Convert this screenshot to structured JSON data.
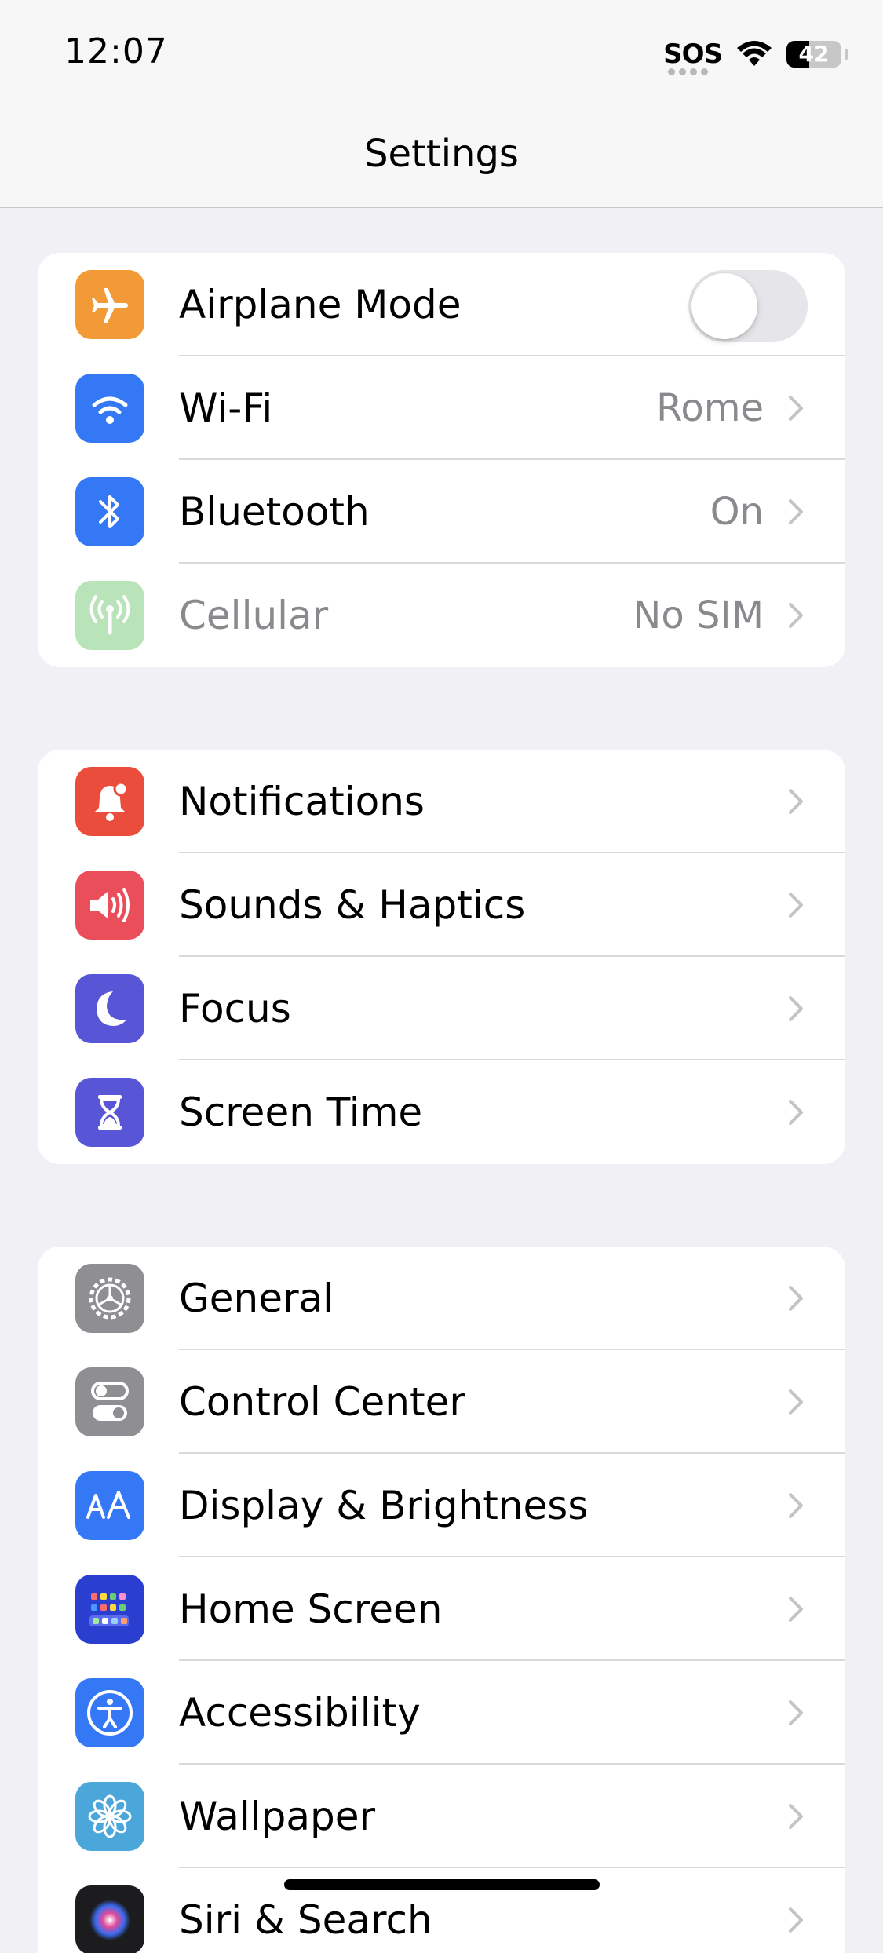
{
  "status_bar": {
    "time": "12:07",
    "carrier": "SOS",
    "battery": "42",
    "battery_level": 0.42
  },
  "nav": {
    "title": "Settings"
  },
  "groups": [
    {
      "rows": [
        {
          "label": "Airplane Mode",
          "icon": "airplane-icon",
          "color": "#F19A37",
          "toggle": false
        },
        {
          "label": "Wi-Fi",
          "value": "Rome",
          "icon": "wifi-icon",
          "color": "#3478F6"
        },
        {
          "label": "Bluetooth",
          "value": "On",
          "icon": "bluetooth-icon",
          "color": "#3478F6"
        },
        {
          "label": "Cellular",
          "value": "No SIM",
          "icon": "cellular-icon",
          "color": "#65C466",
          "disabled": true
        }
      ]
    },
    {
      "rows": [
        {
          "label": "Notifications",
          "icon": "bell-icon",
          "color": "#EB4D3D"
        },
        {
          "label": "Sounds & Haptics",
          "icon": "speaker-icon",
          "color": "#EB4E5B"
        },
        {
          "label": "Focus",
          "icon": "moon-icon",
          "color": "#5856D6"
        },
        {
          "label": "Screen Time",
          "icon": "hourglass-icon",
          "color": "#5856D6"
        }
      ]
    },
    {
      "rows": [
        {
          "label": "General",
          "icon": "gear-icon",
          "color": "#8E8E93"
        },
        {
          "label": "Control Center",
          "icon": "switches-icon",
          "color": "#8E8E93"
        },
        {
          "label": "Display & Brightness",
          "icon": "text-size-icon",
          "color": "#3478F6"
        },
        {
          "label": "Home Screen",
          "icon": "app-grid-icon",
          "color": "#2A3FD0"
        },
        {
          "label": "Accessibility",
          "icon": "accessibility-icon",
          "color": "#3478F6"
        },
        {
          "label": "Wallpaper",
          "icon": "flower-icon",
          "color": "#4BA6D9"
        },
        {
          "label": "Siri & Search",
          "icon": "siri-icon",
          "color": "#1C1C1E"
        }
      ]
    }
  ]
}
